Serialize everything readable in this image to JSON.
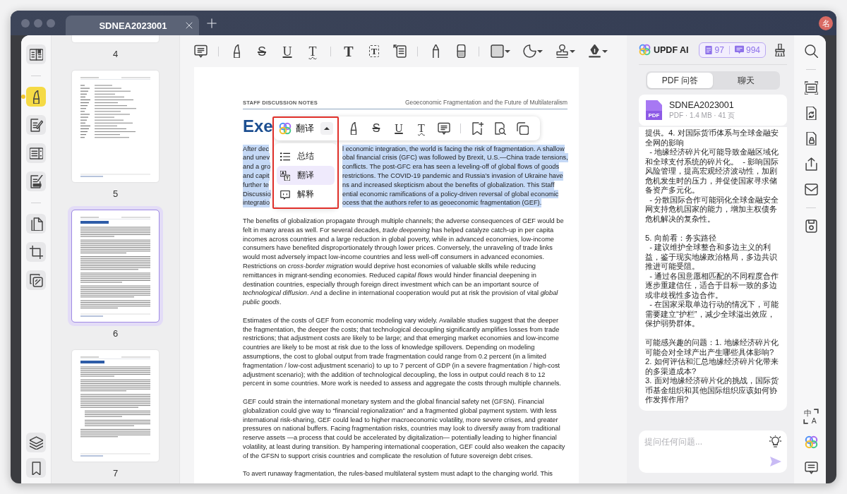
{
  "window": {
    "tabs": [
      {
        "title": "SDNEA2023001",
        "selected": true
      }
    ],
    "avatar": "名"
  },
  "left_rail": {
    "groups": [
      [
        {
          "kind": "reader",
          "selected": false
        }
      ],
      [
        {
          "kind": "highlight",
          "selected": true
        },
        {
          "kind": "edit",
          "selected": false
        },
        {
          "kind": "form",
          "selected": false
        },
        {
          "kind": "fillsign",
          "selected": false
        }
      ],
      [
        {
          "kind": "pages",
          "selected": false
        },
        {
          "kind": "crop",
          "selected": false
        },
        {
          "kind": "batch",
          "selected": false
        }
      ]
    ],
    "bottom_items": [
      {
        "kind": "layers",
        "selected": false
      },
      {
        "kind": "bookmark",
        "selected": false
      }
    ]
  },
  "thumbnails": [
    {
      "label": "4",
      "kind": "cut",
      "selected": false
    },
    {
      "label": "5",
      "kind": "list",
      "selected": false
    },
    {
      "label": "6",
      "kind": "summary",
      "selected": true
    },
    {
      "label": "7",
      "kind": "intro",
      "selected": false
    }
  ],
  "toolbar": {
    "groups": [
      [
        {
          "kind": "note",
          "dropdown": false
        }
      ],
      [
        {
          "kind": "highlight",
          "dropdown": false
        },
        {
          "kind": "strike",
          "glyph": "S",
          "dropdown": false
        },
        {
          "kind": "underline",
          "glyph": "U",
          "dropdown": false
        },
        {
          "kind": "squiggly",
          "glyph": "T",
          "dropdown": false
        }
      ],
      [
        {
          "kind": "text",
          "glyph": "T",
          "dropdown": false
        },
        {
          "kind": "textbox",
          "glyph": "T",
          "dropdown": false
        },
        {
          "kind": "callout",
          "dropdown": false
        }
      ],
      [
        {
          "kind": "pencil",
          "dropdown": false
        },
        {
          "kind": "eraser",
          "dropdown": false
        }
      ],
      [
        {
          "kind": "shape",
          "dropdown": true
        },
        {
          "kind": "sticker",
          "dropdown": true
        },
        {
          "kind": "stamp",
          "dropdown": true
        },
        {
          "kind": "signature",
          "dropdown": true
        }
      ]
    ]
  },
  "document": {
    "header_left": "STAFF DISCUSSION NOTES",
    "header_right": "Geoeconomic Fragmentation and the Future of Multilateralism",
    "heading": "Exe",
    "selected_lines": [
      {
        "left": "After dec",
        "right": "l economic integration, the world is facing the risk of fragmentation. A shallow"
      },
      {
        "left": "and unev",
        "right": "obal financial crisis (GFC) was followed by Brexit, U.S.—China trade tensions,"
      },
      {
        "left": "and a gro",
        "right": "conflicts. The post-GFC era has seen a leveling-off of global flows of goods"
      },
      {
        "left": "and capit",
        "right": "restrictions. The COVID-19 pandemic and Russia’s invasion of Ukraine have"
      },
      {
        "left": "further te",
        "right": "ns and increased skepticism about the benefits of globalization. This Staff"
      },
      {
        "left": "Discussio",
        "right": "ential economic ramifications of a policy-driven reversal of global economic"
      },
      {
        "left": "integratio",
        "right": "ocess that the authors refer to as geoeconomic fragmentation (GEF)."
      }
    ],
    "paragraphs": [
      "The benefits of globalization propagate through multiple channels; the adverse consequences of GEF would be felt in many areas as well. For several decades, *trade deepening* has helped catalyze catch-up in per capita incomes across countries and a large reduction in global poverty, while in advanced economies, low-income consumers have benefited disproportionately through lower prices. Conversely, the unraveling of trade links would most adversely impact low-income countries and less well-off consumers in advanced economies. Restrictions on *cross-border migration* would deprive host economies of valuable skills while reducing remittances in migrant-sending economies. Reduced *capital flows* would hinder financial deepening in destination countries, especially through foreign direct investment which can be an important source of *technological diffusion*. And a decline in international cooperation would put at risk the provision of vital *global public goods*.",
      "Estimates of the costs of GEF from economic modeling vary widely. Available studies suggest that the deeper the fragmentation, the deeper the costs; that technological decoupling significantly amplifies losses from trade restrictions; that adjustment costs are likely to be large; and that emerging market economies and low-income countries are likely to be most at risk due to the loss of knowledge spillovers. Depending on modeling assumptions, the cost to global output from trade fragmentation could range from 0.2 percent (in a limited fragmentation / low-cost adjustment scenario) to up to 7 percent of GDP (in a severe fragmentation / high-cost adjustment scenario); with the addition of technological decoupling, the loss in output could reach 8 to 12 percent in some countries. More work is needed to assess and aggregate the costs through multiple channels.",
      "GEF could strain the international monetary system and the global financial safety net (GFSN). Financial globalization could give way to “financial regionalization” and a fragmented global payment system. With less international risk-sharing, GEF could lead to higher macroeconomic volatility, more severe crises, and greater pressures on national buffers. Facing fragmentation risks, countries may look to diversify away from traditional reserve assets —a process that could be accelerated by digitalization— potentially leading to higher financial volatility, at least during transition. By hampering international cooperation, GEF could also weaken the capacity of the GFSN to support crisis countries and complicate the resolution of future sovereign debt crises.",
      "To avert runaway fragmentation, the rules-based multilateral system must adapt to the changing world. This"
    ]
  },
  "selection_toolbar": {
    "ai_action": {
      "label": "翻译",
      "expanded": true
    },
    "groups": [
      [
        {
          "kind": "highlight",
          "dropdown": false
        },
        {
          "kind": "strike",
          "glyph": "S",
          "dropdown": false
        },
        {
          "kind": "underline",
          "glyph": "U",
          "dropdown": false
        },
        {
          "kind": "squiggly",
          "glyph": "T",
          "dropdown": false
        },
        {
          "kind": "note",
          "dropdown": false
        }
      ],
      [
        {
          "kind": "bookmark_add",
          "dropdown": false
        },
        {
          "kind": "page_search",
          "dropdown": false
        },
        {
          "kind": "copy",
          "dropdown": false
        }
      ]
    ],
    "menu": [
      {
        "kind": "summary",
        "label": "总结",
        "selected": false
      },
      {
        "kind": "translate",
        "label": "翻译",
        "selected": true
      },
      {
        "kind": "explain",
        "label": "解释",
        "selected": false
      }
    ],
    "annotation_frame": true
  },
  "ai_panel": {
    "title": "UPDF AI",
    "quota": {
      "pages": "97",
      "questions": "994"
    },
    "modes": [
      {
        "label": "PDF 问答",
        "selected": true
      },
      {
        "label": "聊天",
        "selected": false
      }
    ],
    "file": {
      "icon_label": "PDF",
      "name": "SDNEA2023001",
      "details": "PDF · 1.4 MB · 41 页"
    },
    "message": [
      "提供。4. 对国际货币体系与全球金融安全网的影响\n  - 地缘经济碎片化可能导致金融区域化和全球支付系统的碎片化。  - 影响国际风险管理，提高宏观经济波动性，加剧危机发生时的压力，并促使国家寻求储备资产多元化。\n  - 分散国际合作可能弱化全球金融安全网支持危机国家的能力，增加主权债务危机解决的复杂性。",
      "5. 向前看：务实路径\n  - 建议维护全球整合和多边主义的利益，鉴于现实地缘政治格局，多边共识推进可能受阻。\n  - 通过各国意愿相匹配的不同程度合作逐步重建信任，适合于目标一致的多边或非歧视性多边合作。\n  - 在国家采取单边行动的情况下，可能需要建立“护栏”，减少全球溢出效应，保护弱势群体。",
      "可能感兴趣的问题：1. 地缘经济碎片化可能会对全球产出产生哪些具体影响?\n2. 如何评估和汇总地缘经济碎片化带来的多渠道成本?\n3. 面对地缘经济碎片化的挑战，国际货币基金组织和其他国际组织应该如何协作发挥作用?"
    ],
    "input": {
      "placeholder": "提问任何问题..."
    }
  },
  "right_rail": {
    "groups": [
      [
        {
          "kind": "search"
        }
      ],
      [
        {
          "kind": "ocr"
        },
        {
          "kind": "convert"
        },
        {
          "kind": "protect"
        },
        {
          "kind": "share"
        },
        {
          "kind": "email"
        }
      ],
      [
        {
          "kind": "save"
        }
      ]
    ],
    "bottom_items": [
      {
        "kind": "translate",
        "glyphs": [
          "中",
          "A"
        ]
      },
      {
        "kind": "ai"
      },
      {
        "kind": "comment"
      }
    ]
  }
}
